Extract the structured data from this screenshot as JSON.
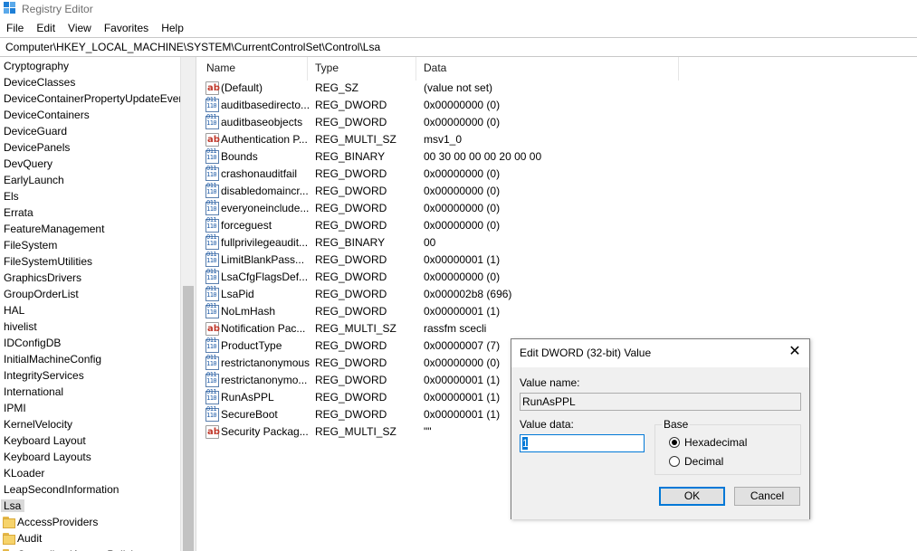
{
  "window": {
    "title": "Registry Editor"
  },
  "menu": [
    "File",
    "Edit",
    "View",
    "Favorites",
    "Help"
  ],
  "address": "Computer\\HKEY_LOCAL_MACHINE\\SYSTEM\\CurrentControlSet\\Control\\Lsa",
  "tree": {
    "items": [
      "Cryptography",
      "DeviceClasses",
      "DeviceContainerPropertyUpdateEvents",
      "DeviceContainers",
      "DeviceGuard",
      "DevicePanels",
      "DevQuery",
      "EarlyLaunch",
      "Els",
      "Errata",
      "FeatureManagement",
      "FileSystem",
      "FileSystemUtilities",
      "GraphicsDrivers",
      "GroupOrderList",
      "HAL",
      "hivelist",
      "IDConfigDB",
      "InitialMachineConfig",
      "IntegrityServices",
      "International",
      "IPMI",
      "KernelVelocity",
      "Keyboard Layout",
      "Keyboard Layouts",
      "KLoader",
      "LeapSecondInformation"
    ],
    "selected": "Lsa",
    "children": [
      "AccessProviders",
      "Audit",
      "CentralizedAccessPolicies"
    ]
  },
  "list": {
    "columns": [
      "Name",
      "Type",
      "Data"
    ],
    "rows": [
      {
        "icon": "string-value-icon",
        "name": "(Default)",
        "type": "REG_SZ",
        "data": "(value not set)"
      },
      {
        "icon": "binary-value-icon",
        "name": "auditbasedirectories",
        "type": "REG_DWORD",
        "data": "0x00000000 (0)"
      },
      {
        "icon": "binary-value-icon",
        "name": "auditbaseobjects",
        "type": "REG_DWORD",
        "data": "0x00000000 (0)"
      },
      {
        "icon": "string-value-icon",
        "name": "Authentication Packages",
        "type": "REG_MULTI_SZ",
        "data": "msv1_0"
      },
      {
        "icon": "binary-value-icon",
        "name": "Bounds",
        "type": "REG_BINARY",
        "data": "00 30 00 00 00 20 00 00"
      },
      {
        "icon": "binary-value-icon",
        "name": "crashonauditfail",
        "type": "REG_DWORD",
        "data": "0x00000000 (0)"
      },
      {
        "icon": "binary-value-icon",
        "name": "disabledomaincreds",
        "type": "REG_DWORD",
        "data": "0x00000000 (0)"
      },
      {
        "icon": "binary-value-icon",
        "name": "everyoneincludesanonymous",
        "type": "REG_DWORD",
        "data": "0x00000000 (0)"
      },
      {
        "icon": "binary-value-icon",
        "name": "forceguest",
        "type": "REG_DWORD",
        "data": "0x00000000 (0)"
      },
      {
        "icon": "binary-value-icon",
        "name": "fullprivilegeauditing",
        "type": "REG_BINARY",
        "data": "00"
      },
      {
        "icon": "binary-value-icon",
        "name": "LimitBlankPasswordUse",
        "type": "REG_DWORD",
        "data": "0x00000001 (1)"
      },
      {
        "icon": "binary-value-icon",
        "name": "LsaCfgFlagsDefault",
        "type": "REG_DWORD",
        "data": "0x00000000 (0)"
      },
      {
        "icon": "binary-value-icon",
        "name": "LsaPid",
        "type": "REG_DWORD",
        "data": "0x000002b8 (696)"
      },
      {
        "icon": "binary-value-icon",
        "name": "NoLmHash",
        "type": "REG_DWORD",
        "data": "0x00000001 (1)"
      },
      {
        "icon": "string-value-icon",
        "name": "Notification Packages",
        "type": "REG_MULTI_SZ",
        "data": "rassfm scecli"
      },
      {
        "icon": "binary-value-icon",
        "name": "ProductType",
        "type": "REG_DWORD",
        "data": "0x00000007 (7)"
      },
      {
        "icon": "binary-value-icon",
        "name": "restrictanonymous",
        "type": "REG_DWORD",
        "data": "0x00000000 (0)"
      },
      {
        "icon": "binary-value-icon",
        "name": "restrictanonymoussam",
        "type": "REG_DWORD",
        "data": "0x00000001 (1)"
      },
      {
        "icon": "binary-value-icon",
        "name": "RunAsPPL",
        "type": "REG_DWORD",
        "data": "0x00000001 (1)"
      },
      {
        "icon": "binary-value-icon",
        "name": "SecureBoot",
        "type": "REG_DWORD",
        "data": "0x00000001 (1)"
      },
      {
        "icon": "string-value-icon",
        "name": "Security Packages",
        "type": "REG_MULTI_SZ",
        "data": "\"\""
      }
    ]
  },
  "dialog": {
    "title": "Edit DWORD (32-bit) Value",
    "value_name_label": "Value name:",
    "value_name": "RunAsPPL",
    "value_data_label": "Value data:",
    "value_data": "1",
    "base_label": "Base",
    "hex_label": "Hexadecimal",
    "dec_label": "Decimal",
    "selected_base": "Hexadecimal",
    "ok_label": "OK",
    "cancel_label": "Cancel",
    "close_glyph": "✕"
  },
  "colors": {
    "accent": "#0078d7",
    "selection": "#d9d9d9",
    "folder": "#f6d36b"
  }
}
